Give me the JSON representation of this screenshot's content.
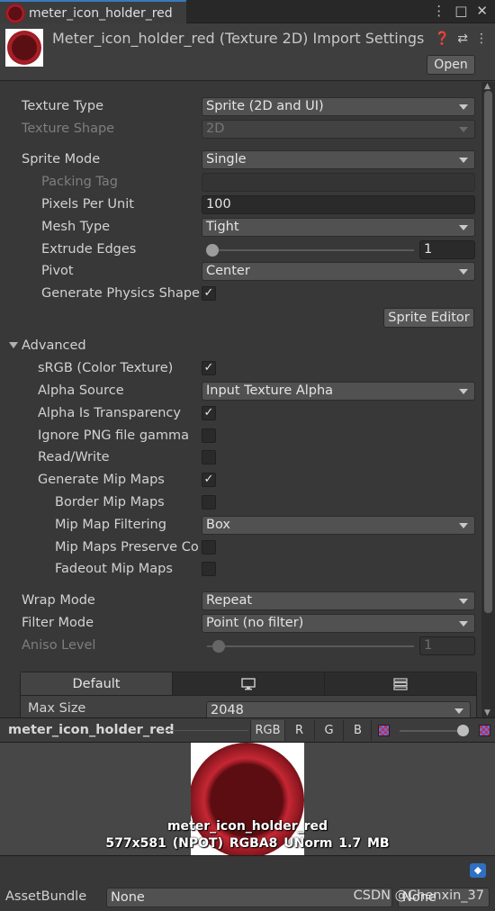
{
  "tab": {
    "label": "meter_icon_holder_red"
  },
  "header": {
    "title": "Meter_icon_holder_red (Texture 2D) Import Settings",
    "open_label": "Open"
  },
  "inspector": {
    "texture_type": {
      "label": "Texture Type",
      "value": "Sprite (2D and UI)"
    },
    "texture_shape": {
      "label": "Texture Shape",
      "value": "2D"
    },
    "sprite_mode": {
      "label": "Sprite Mode",
      "value": "Single"
    },
    "packing_tag": {
      "label": "Packing Tag",
      "value": ""
    },
    "pixels_per_unit": {
      "label": "Pixels Per Unit",
      "value": "100"
    },
    "mesh_type": {
      "label": "Mesh Type",
      "value": "Tight"
    },
    "extrude_edges": {
      "label": "Extrude Edges",
      "value": "1"
    },
    "pivot": {
      "label": "Pivot",
      "value": "Center"
    },
    "generate_physics_shape": {
      "label": "Generate Physics Shape",
      "checked": true
    },
    "sprite_editor_label": "Sprite Editor",
    "advanced": {
      "label": "Advanced",
      "srgb": {
        "label": "sRGB (Color Texture)",
        "checked": true
      },
      "alpha_source": {
        "label": "Alpha Source",
        "value": "Input Texture Alpha"
      },
      "alpha_is_transparency": {
        "label": "Alpha Is Transparency",
        "checked": true
      },
      "ignore_png_gamma": {
        "label": "Ignore PNG file gamma",
        "checked": false
      },
      "read_write": {
        "label": "Read/Write",
        "checked": false
      },
      "generate_mip_maps": {
        "label": "Generate Mip Maps",
        "checked": true
      },
      "border_mip_maps": {
        "label": "Border Mip Maps",
        "checked": false
      },
      "mip_map_filtering": {
        "label": "Mip Map Filtering",
        "value": "Box"
      },
      "mip_maps_preserve_coverage": {
        "label": "Mip Maps Preserve Co",
        "checked": false
      },
      "fadeout_mip_maps": {
        "label": "Fadeout Mip Maps",
        "checked": false
      }
    },
    "wrap_mode": {
      "label": "Wrap Mode",
      "value": "Repeat"
    },
    "filter_mode": {
      "label": "Filter Mode",
      "value": "Point (no filter)"
    },
    "aniso_level": {
      "label": "Aniso Level",
      "value": "1"
    },
    "platform_tabs": {
      "default_label": "Default"
    },
    "max_size": {
      "label": "Max Size",
      "value": "2048"
    }
  },
  "preview": {
    "title": "meter_icon_holder_red",
    "channels": [
      "RGB",
      "R",
      "G",
      "B"
    ],
    "image_name": "meter_icon_holder_red",
    "image_info": "577x581 (NPOT)  RGBA8 UNorm   1.7 MB"
  },
  "asset_bundle": {
    "label": "AssetBundle",
    "name_value": "None",
    "variant_value": "None"
  },
  "watermark": "CSDN @Chenxin_37"
}
